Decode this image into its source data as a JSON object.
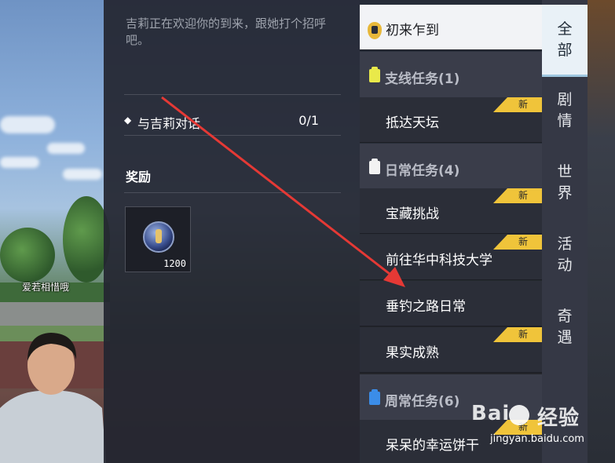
{
  "scene": {
    "player_name": "爱若相惜哦"
  },
  "detail": {
    "description": "吉莉正在欢迎你的到来，跟她打个招呼吧。",
    "objective": {
      "text": "与吉莉对话",
      "progress": "0/1"
    },
    "reward_title": "奖励",
    "reward": {
      "icon": "key-coin-icon",
      "quantity": "1200"
    }
  },
  "quest_list": {
    "active_quest": "初来乍到",
    "categories": [
      {
        "name": "支线任务(1)",
        "icon_color": "#e9e94a",
        "quests": [
          {
            "label": "抵达天坛",
            "badge": "新"
          }
        ]
      },
      {
        "name": "日常任务(4)",
        "icon_color": "#f2f2f2",
        "quests": [
          {
            "label": "宝藏挑战",
            "badge": "新"
          },
          {
            "label": "前往华中科技大学",
            "badge": "新"
          },
          {
            "label": "垂钓之路日常",
            "badge": ""
          },
          {
            "label": "果实成熟",
            "badge": "新"
          }
        ]
      },
      {
        "name": "周常任务(6)",
        "icon_color": "#3b8de8",
        "quests": [
          {
            "label": "呆呆的幸运饼干",
            "badge": "新"
          }
        ]
      }
    ],
    "badge_color": "#f0c43a"
  },
  "tabs": [
    {
      "label": "全部",
      "active": true
    },
    {
      "label": "剧情",
      "active": false
    },
    {
      "label": "世界",
      "active": false
    },
    {
      "label": "活动",
      "active": false
    },
    {
      "label": "奇遇",
      "active": false
    }
  ],
  "annotation": {
    "arrow_color": "#e53935"
  },
  "watermark": {
    "brand_left": "Bai",
    "brand_right": "经验",
    "url": "jingyan.baidu.com"
  }
}
